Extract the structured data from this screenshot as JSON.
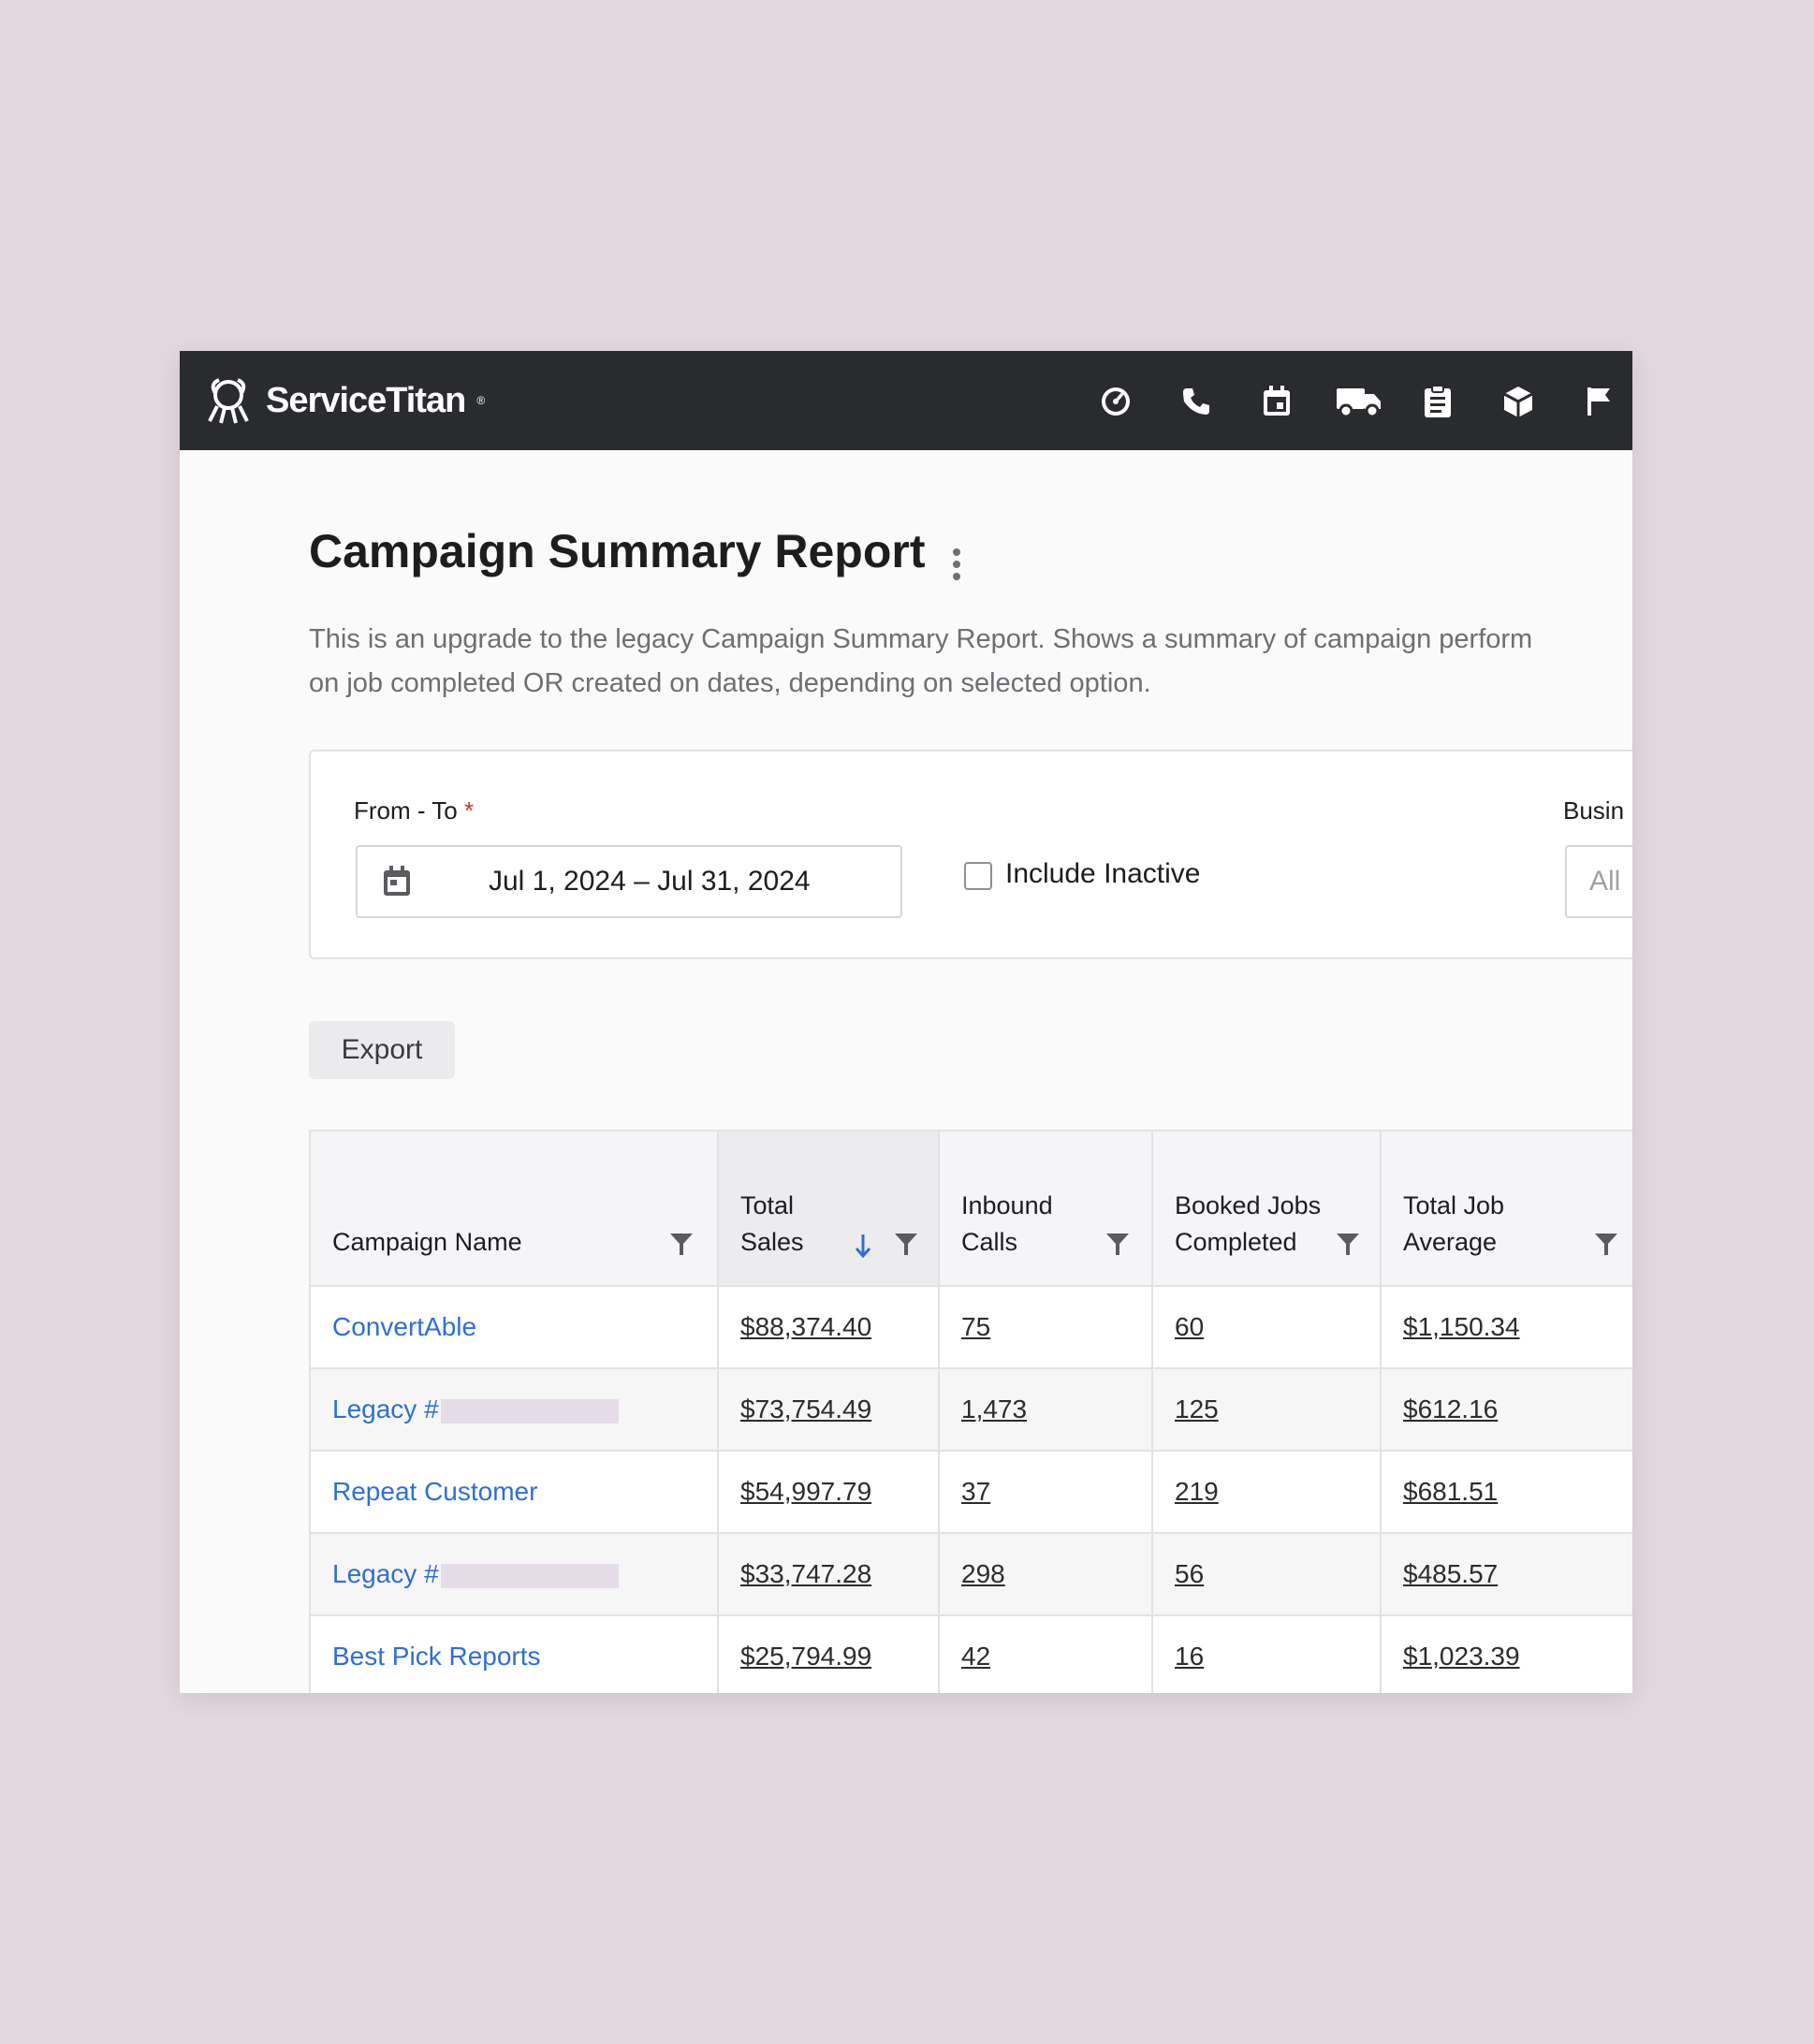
{
  "app": {
    "brand": "ServiceTitan",
    "nav_icons": [
      "dashboard-icon",
      "phone-icon",
      "calendar-icon",
      "truck-icon",
      "clipboard-icon",
      "box-icon",
      "flag-icon"
    ]
  },
  "page": {
    "title": "Campaign Summary Report",
    "description_line1": "This is an upgrade to the legacy Campaign Summary Report. Shows a summary of campaign perform",
    "description_line2": "on job completed OR created on dates, depending on selected option."
  },
  "filters": {
    "date_label": "From - To",
    "required_mark": "*",
    "date_value": "Jul 1, 2024 – Jul 31, 2024",
    "include_inactive_label": "Include Inactive",
    "include_inactive_checked": false,
    "business_label": "Busin",
    "business_placeholder": "All"
  },
  "toolbar": {
    "export_label": "Export"
  },
  "table": {
    "columns": [
      {
        "line1": "",
        "line2": "Campaign Name"
      },
      {
        "line1": "Total",
        "line2": "Sales",
        "sort": "descending"
      },
      {
        "line1": "Inbound",
        "line2": "Calls"
      },
      {
        "line1": "Booked Jobs",
        "line2": "Completed"
      },
      {
        "line1": "Total Job",
        "line2": "Average"
      }
    ],
    "rows": [
      {
        "campaign": "ConvertAble",
        "redacted": false,
        "total_sales": "$88,374.40",
        "inbound_calls": "75",
        "booked_jobs_completed": "60",
        "total_job_average": "$1,150.34"
      },
      {
        "campaign": "Legacy #",
        "redacted": true,
        "total_sales": "$73,754.49",
        "inbound_calls": "1,473",
        "booked_jobs_completed": "125",
        "total_job_average": "$612.16"
      },
      {
        "campaign": "Repeat Customer",
        "redacted": false,
        "total_sales": "$54,997.79",
        "inbound_calls": "37",
        "booked_jobs_completed": "219",
        "total_job_average": "$681.51"
      },
      {
        "campaign": "Legacy #",
        "redacted": true,
        "total_sales": "$33,747.28",
        "inbound_calls": "298",
        "booked_jobs_completed": "56",
        "total_job_average": "$485.57"
      },
      {
        "campaign": "Best Pick Reports",
        "redacted": false,
        "total_sales": "$25,794.99",
        "inbound_calls": "42",
        "booked_jobs_completed": "16",
        "total_job_average": "$1,023.39"
      }
    ]
  },
  "colors": {
    "topbar": "#2a2b2f",
    "link": "#2f6fd1",
    "background": "#e3d8df",
    "sort_arrow": "#2f6fd1",
    "required": "#c0392b"
  }
}
